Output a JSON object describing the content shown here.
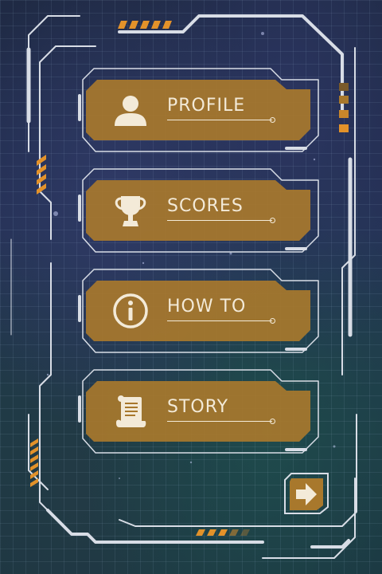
{
  "menu": {
    "items": [
      {
        "id": "profile",
        "label": "PROFILE",
        "icon": "user-icon"
      },
      {
        "id": "scores",
        "label": "SCORES",
        "icon": "trophy-icon"
      },
      {
        "id": "howto",
        "label": "HOW TO",
        "icon": "info-icon"
      },
      {
        "id": "story",
        "label": "STORY",
        "icon": "scroll-icon"
      }
    ]
  },
  "next_button": {
    "icon": "arrow-right-icon"
  },
  "colors": {
    "button_fill": "#a8782c",
    "frame_stroke": "#d8dde6",
    "accent": "#e3922a",
    "label": "#f3ead8"
  }
}
